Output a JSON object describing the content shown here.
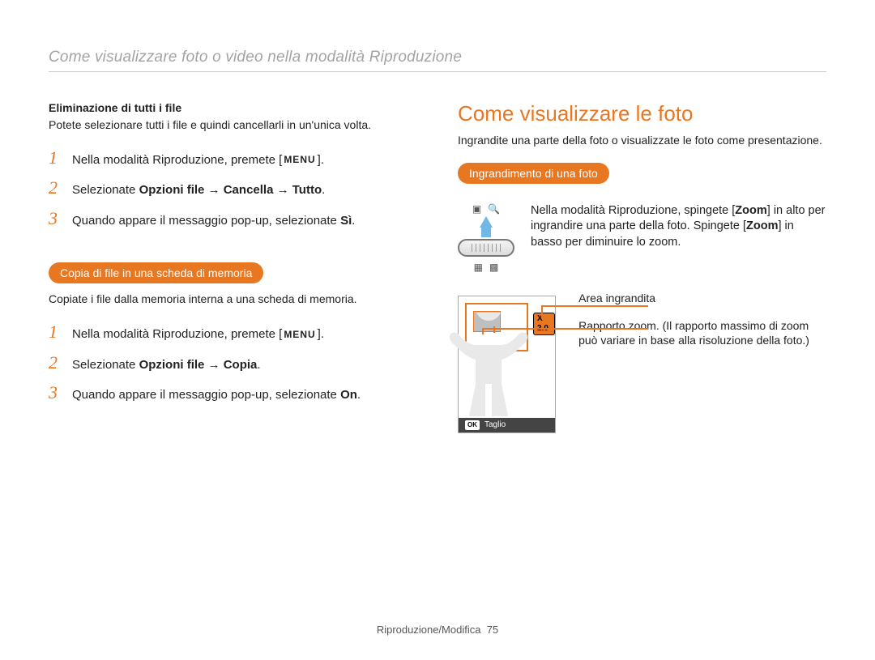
{
  "header": {
    "title": "Come visualizzare foto o video nella modalità Riproduzione"
  },
  "left": {
    "delete": {
      "heading": "Eliminazione di tutti i file",
      "desc": "Potete selezionare tutti i file e quindi cancellarli in un'unica volta.",
      "steps": {
        "s1a": "Nella modalità Riproduzione, premete [",
        "s1menu": "MENU",
        "s1b": "].",
        "s2a": "Selezionate ",
        "s2b": "Opzioni file → Cancella → Tutto",
        "s2c": ".",
        "s3a": "Quando appare il messaggio pop-up, selezionate ",
        "s3b": "Sì",
        "s3c": "."
      }
    },
    "copy": {
      "pill": "Copia di file in una scheda di memoria",
      "desc": "Copiate i file dalla memoria interna a una scheda di memoria.",
      "steps": {
        "s1a": "Nella modalità Riproduzione, premete [",
        "s1menu": "MENU",
        "s1b": "].",
        "s2a": "Selezionate ",
        "s2b": "Opzioni file → Copia",
        "s2c": ".",
        "s3a": "Quando appare il messaggio pop-up, selezionate ",
        "s3b": "On",
        "s3c": "."
      }
    },
    "numbers": {
      "n1": "1",
      "n2": "2",
      "n3": "3"
    }
  },
  "right": {
    "title": "Come visualizzare le foto",
    "intro": "Ingrandite una parte della foto o visualizzate le foto come presentazione.",
    "pill": "Ingrandimento di una foto",
    "zoom_desc": {
      "a": "Nella modalità Riproduzione, spingete [",
      "z": "Zoom",
      "b": "] in alto per ingrandire una parte della foto. Spingete [",
      "c": "] in basso per diminuire lo zoom."
    },
    "x_badge": "X 2.0",
    "taglio_ok": "OK",
    "taglio": "Taglio",
    "label1": "Area ingrandita",
    "label2": "Rapporto zoom. (Il rapporto massimo di zoom può variare in base alla risoluzione della foto.)"
  },
  "footer": {
    "section": "Riproduzione/Modifica",
    "page": "75"
  }
}
